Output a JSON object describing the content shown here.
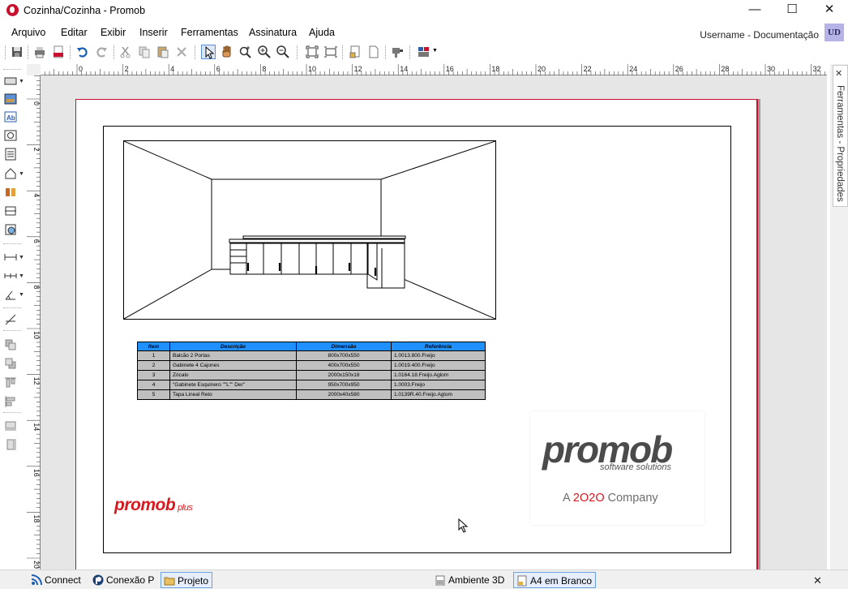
{
  "window": {
    "title": "Cozinha/Cozinha - Promob",
    "minimize": "—",
    "maximize": "☐",
    "close": "✕"
  },
  "menu": {
    "items": [
      "Arquivo",
      "Editar",
      "Exibir",
      "Inserir",
      "Ferramentas",
      "Assinatura",
      "Ajuda"
    ],
    "user_label": "Username - Documentação",
    "avatar_initials": "UD"
  },
  "ruler": {
    "h_labels": [
      "0",
      "2",
      "4",
      "6",
      "8",
      "10",
      "12",
      "14",
      "16",
      "18",
      "20",
      "22",
      "24",
      "26",
      "28",
      "30",
      "32"
    ],
    "v_labels": [
      "0",
      "2",
      "4",
      "6",
      "8",
      "10",
      "12",
      "14",
      "16",
      "18",
      "20"
    ]
  },
  "right_panel": {
    "tab_label": "Ferramentas - Propriedades",
    "close": "✕"
  },
  "parts_table": {
    "headers": [
      "Item",
      "Descrição",
      "Dimensão",
      "Referência"
    ],
    "rows": [
      [
        "1",
        "Balcão 2 Portas",
        "800x700x550",
        "1.0013.800.Freijo"
      ],
      [
        "2",
        "Gabinete 4 Cajones",
        "400x700x550",
        "1.0019.400.Freijo"
      ],
      [
        "3",
        "Zócalo",
        "2000x150x18",
        "1.0164.18.Freijo.Aglom"
      ],
      [
        "4",
        "\"Gabinete Esquinero \"\"L\"\" Der\"",
        "950x700x950",
        "1.0003.Freijo"
      ],
      [
        "5",
        "Tapa Lineal Reto",
        "2000x40x580",
        "1.0139R.40.Freijo.Aglom"
      ]
    ]
  },
  "branding": {
    "plus_main": "promob",
    "plus_suffix": "plus",
    "logo_main": "promob",
    "logo_sub": "software solutions",
    "company_prefix": "A ",
    "company_mark": "2O2O",
    "company_suffix": " Company"
  },
  "statusbar": {
    "connect": "Connect",
    "conexao": "Conexão P",
    "projeto": "Projeto",
    "ambiente": "Ambiente 3D",
    "a4": "A4 em Branco",
    "close": "✕"
  },
  "colors": {
    "accent_red": "#c8102e",
    "table_header_blue": "#1e90ff",
    "table_cell_gray": "#c0c0c0"
  }
}
